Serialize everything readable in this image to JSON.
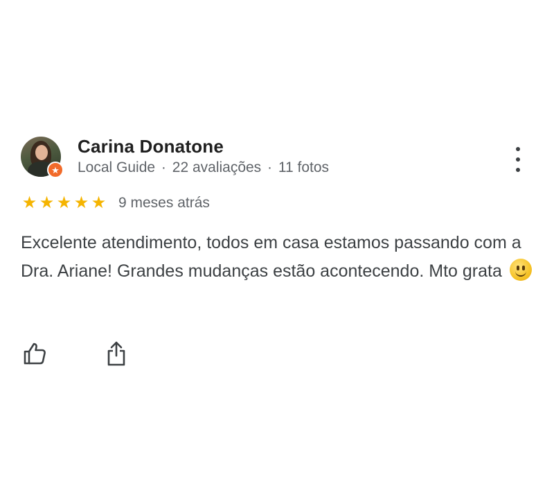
{
  "review": {
    "author_name": "Carina Donatone",
    "author_meta": {
      "badge": "Local Guide",
      "separator": "·",
      "reviews": "22 avaliações",
      "photos": "11 fotos"
    },
    "rating": 5,
    "stars": [
      "★",
      "★",
      "★",
      "★",
      "★"
    ],
    "time_ago": "9 meses atrás",
    "text": "Excelente atendimento, todos em casa estamos passando com a Dra. Ariane! Grandes mudanças estão acontecendo. Mto grata",
    "emoji": "slightly-smiling-face",
    "guide_badge_icon": "★"
  },
  "icons": {
    "more": "more-vert-icon",
    "like": "thumbs-up-icon",
    "share": "share-icon"
  },
  "colors": {
    "star": "#f5b400",
    "guide_badge": "#f26b2a",
    "name": "#1f1f1f",
    "meta": "#5f6368",
    "body_text": "#3c4043"
  }
}
